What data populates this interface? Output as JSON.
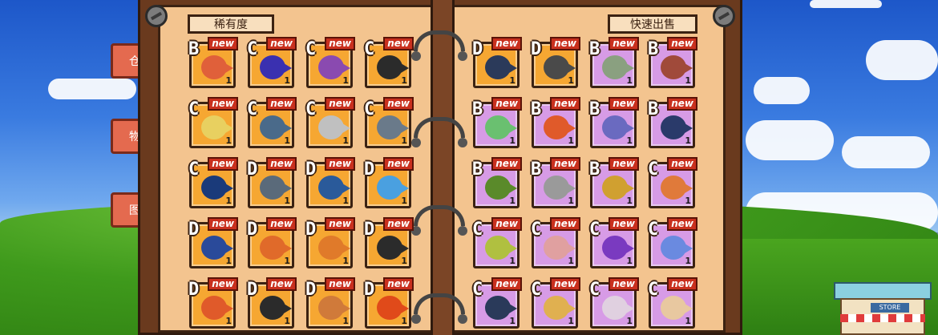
{
  "header": {
    "rarity_label": "稀有度",
    "quick_sell_label": "快速出售"
  },
  "side_tabs": [
    "仓库",
    "物品",
    "图鉴"
  ],
  "new_badge": "new",
  "store_sign": "STORE",
  "left_items": [
    {
      "grade": "B",
      "count": "1",
      "color": "#e0603a",
      "bg": "orange"
    },
    {
      "grade": "C",
      "count": "1",
      "color": "#3a30b0",
      "bg": "orange"
    },
    {
      "grade": "C",
      "count": "1",
      "color": "#8a4ab0",
      "bg": "orange"
    },
    {
      "grade": "C",
      "count": "1",
      "color": "#2b2b2b",
      "bg": "orange"
    },
    {
      "grade": "C",
      "count": "1",
      "color": "#e8d060",
      "bg": "orange"
    },
    {
      "grade": "C",
      "count": "1",
      "color": "#4a6a8a",
      "bg": "orange"
    },
    {
      "grade": "C",
      "count": "1",
      "color": "#c0c0c0",
      "bg": "orange"
    },
    {
      "grade": "C",
      "count": "1",
      "color": "#6a7a8a",
      "bg": "orange"
    },
    {
      "grade": "C",
      "count": "1",
      "color": "#1a3a7a",
      "bg": "orange"
    },
    {
      "grade": "D",
      "count": "1",
      "color": "#5a6a7a",
      "bg": "orange"
    },
    {
      "grade": "D",
      "count": "1",
      "color": "#2a5a9a",
      "bg": "orange"
    },
    {
      "grade": "D",
      "count": "1",
      "color": "#4aa0e0",
      "bg": "orange"
    },
    {
      "grade": "D",
      "count": "1",
      "color": "#2a4a9a",
      "bg": "orange"
    },
    {
      "grade": "D",
      "count": "1",
      "color": "#e06a2a",
      "bg": "orange"
    },
    {
      "grade": "D",
      "count": "1",
      "color": "#e07a2a",
      "bg": "orange"
    },
    {
      "grade": "D",
      "count": "1",
      "color": "#2b2b2b",
      "bg": "orange"
    },
    {
      "grade": "D",
      "count": "1",
      "color": "#e05a2a",
      "bg": "orange"
    },
    {
      "grade": "D",
      "count": "1",
      "color": "#2b2b2b",
      "bg": "orange"
    },
    {
      "grade": "D",
      "count": "1",
      "color": "#d07a3a",
      "bg": "orange"
    },
    {
      "grade": "D",
      "count": "1",
      "color": "#e04a1a",
      "bg": "orange"
    }
  ],
  "right_items": [
    {
      "grade": "D",
      "count": "1",
      "color": "#2b3a5a",
      "bg": "orange"
    },
    {
      "grade": "D",
      "count": "1",
      "color": "#4a4a4a",
      "bg": "orange"
    },
    {
      "grade": "B",
      "count": "1",
      "color": "#8aa080",
      "bg": "purple"
    },
    {
      "grade": "B",
      "count": "1",
      "color": "#a04a3a",
      "bg": "purple"
    },
    {
      "grade": "B",
      "count": "1",
      "color": "#6ac070",
      "bg": "purple"
    },
    {
      "grade": "B",
      "count": "1",
      "color": "#e05a2a",
      "bg": "purple"
    },
    {
      "grade": "B",
      "count": "1",
      "color": "#6a6ac0",
      "bg": "purple"
    },
    {
      "grade": "B",
      "count": "1",
      "color": "#2a3a6a",
      "bg": "purple"
    },
    {
      "grade": "B",
      "count": "1",
      "color": "#5a8a2a",
      "bg": "purple"
    },
    {
      "grade": "B",
      "count": "1",
      "color": "#9a9a9a",
      "bg": "purple"
    },
    {
      "grade": "B",
      "count": "1",
      "color": "#d0a030",
      "bg": "purple"
    },
    {
      "grade": "C",
      "count": "1",
      "color": "#e07a3a",
      "bg": "purple"
    },
    {
      "grade": "C",
      "count": "1",
      "color": "#b0c040",
      "bg": "purple"
    },
    {
      "grade": "C",
      "count": "1",
      "color": "#e0a0a0",
      "bg": "purple"
    },
    {
      "grade": "C",
      "count": "1",
      "color": "#7a3ac0",
      "bg": "purple"
    },
    {
      "grade": "C",
      "count": "1",
      "color": "#6a8ae0",
      "bg": "purple"
    },
    {
      "grade": "C",
      "count": "1",
      "color": "#2a3a5a",
      "bg": "purple"
    },
    {
      "grade": "C",
      "count": "1",
      "color": "#e0b050",
      "bg": "purple"
    },
    {
      "grade": "C",
      "count": "1",
      "color": "#e0d0e0",
      "bg": "purple"
    },
    {
      "grade": "C",
      "count": "1",
      "color": "#e8c8a0",
      "bg": "purple"
    }
  ]
}
